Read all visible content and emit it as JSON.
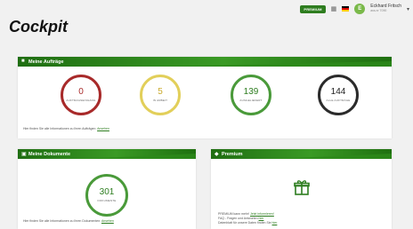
{
  "topbar": {
    "premium_badge": "PREMIUM",
    "user_initial": "E",
    "user_name": "Eckhard Fritsch",
    "user_org": "ara-nr 7090"
  },
  "page_title": "Cockpit",
  "auftraege": {
    "title": "Meine Aufträge",
    "stats": [
      {
        "value": "0",
        "label": "AUFTRAGSEINGANG"
      },
      {
        "value": "5",
        "label": "IN ARBEIT"
      },
      {
        "value": "139",
        "label": "AUSGELIEFERT"
      },
      {
        "value": "144",
        "label": "ALLE AUFTRÄGE"
      }
    ],
    "info_text": "Hier finden Sie alle Informationen zu Ihren Aufträgen:",
    "info_link": "Ansehen"
  },
  "dokumente": {
    "title": "Meine Dokumente",
    "value": "301",
    "label": "DOKUMENTE",
    "info_text": "Hier finden Sie alle Informationen zu Ihren Dokumenten:",
    "info_link": "Ansehen"
  },
  "premium": {
    "title": "Premium",
    "line1_text": "PREMIUM kann mehr!",
    "line1_link": "Jetzt informieren!",
    "line2_text": "FAQ - Fragen und Antworten",
    "line2_link": "hier",
    "line3_text": "Datenblatt für unsere Daten finden Sie",
    "line3_link": "hier"
  },
  "colors": {
    "brand_green": "#2d7d1f",
    "red": "#a82a2a",
    "yellow": "#e2cf5a",
    "dark": "#2b2b2b"
  }
}
